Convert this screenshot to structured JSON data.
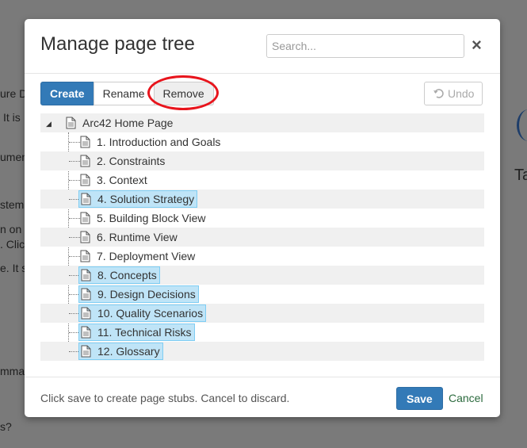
{
  "background": {
    "fragments": [
      "ure D",
      "It is",
      "umen",
      "stem",
      "n on",
      ". Clic",
      "e. It s",
      "mma",
      "s?",
      "Ta"
    ]
  },
  "modal": {
    "title": "Manage page tree",
    "search_placeholder": "Search...",
    "close_glyph": "×"
  },
  "toolbar": {
    "create_label": "Create",
    "rename_label": "Rename",
    "remove_label": "Remove",
    "undo_label": "Undo"
  },
  "tree": {
    "root": "Arc42 Home Page",
    "items": [
      {
        "label": "1. Introduction and Goals",
        "selected": false
      },
      {
        "label": "2. Constraints",
        "selected": false
      },
      {
        "label": "3. Context",
        "selected": false
      },
      {
        "label": "4. Solution Strategy",
        "selected": true
      },
      {
        "label": "5. Building Block View",
        "selected": false
      },
      {
        "label": "6. Runtime View",
        "selected": false
      },
      {
        "label": "7. Deployment View",
        "selected": false
      },
      {
        "label": "8. Concepts",
        "selected": true
      },
      {
        "label": "9. Design Decisions",
        "selected": true
      },
      {
        "label": "10. Quality Scenarios",
        "selected": true
      },
      {
        "label": "11. Technical Risks",
        "selected": true
      },
      {
        "label": "12. Glossary",
        "selected": true
      }
    ]
  },
  "footer": {
    "hint": "Click save to create page stubs. Cancel to discard.",
    "save_label": "Save",
    "cancel_label": "Cancel"
  },
  "colors": {
    "primary": "#337ab7",
    "selection": "#bfe4f7",
    "annotation_ring": "#e8141c",
    "cancel_link": "#2b6a3d"
  }
}
